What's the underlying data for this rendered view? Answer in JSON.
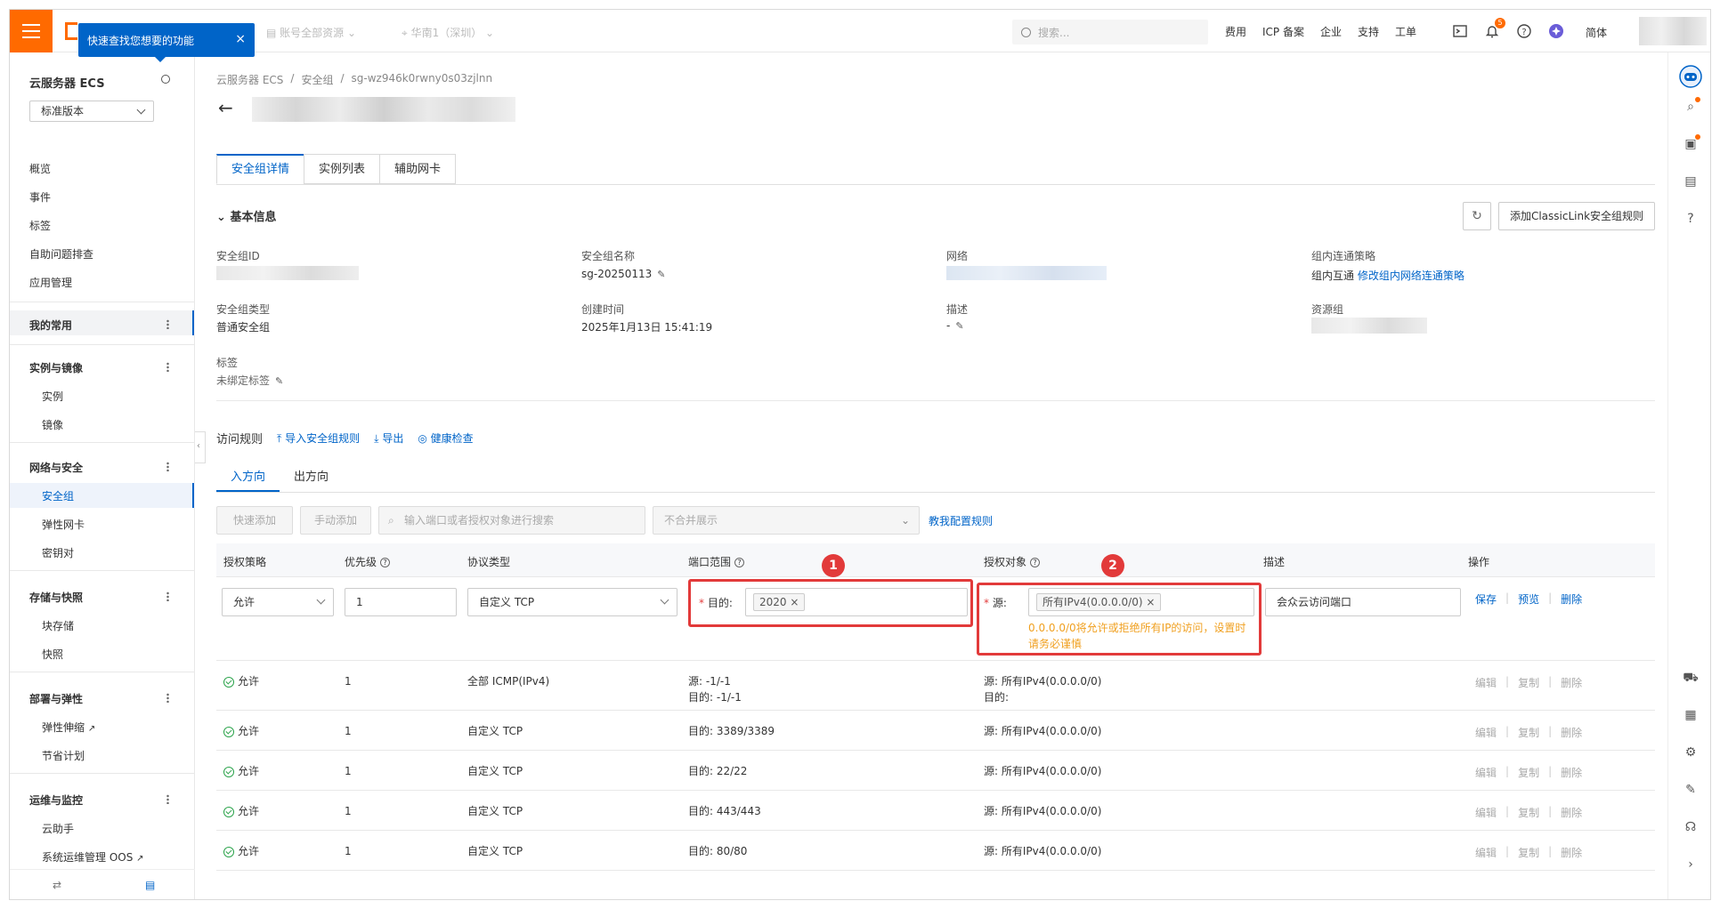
{
  "topbar": {
    "tooltip_text": "快速查找您想要的功能",
    "tooltip_close": "×",
    "resource_scope": "账号全部资源",
    "region": "华南1（深圳）",
    "search_placeholder": "搜索...",
    "links": [
      "费用",
      "ICP 备案",
      "企业",
      "支持",
      "工单"
    ],
    "notification_count": "5",
    "language": "简体"
  },
  "sidebar": {
    "title": "云服务器 ECS",
    "version_select": "标准版本",
    "top_items": [
      "概览",
      "事件",
      "标签",
      "自助问题排查",
      "应用管理"
    ],
    "favorites": "我的常用",
    "groups": [
      {
        "name": "实例与镜像",
        "items": [
          "实例",
          "镜像"
        ]
      },
      {
        "name": "网络与安全",
        "items": [
          "安全组",
          "弹性网卡",
          "密钥对"
        ]
      },
      {
        "name": "存储与快照",
        "items": [
          "块存储",
          "快照"
        ]
      },
      {
        "name": "部署与弹性",
        "items": [
          "弹性伸缩",
          "节省计划"
        ]
      },
      {
        "name": "运维与监控",
        "items": [
          "云助手",
          "系统运维管理 OOS"
        ]
      }
    ]
  },
  "breadcrumb": [
    "云服务器 ECS",
    "/",
    "安全组",
    "/",
    "sg-wz946k0rwny0s03zjlnn"
  ],
  "tabs": [
    "安全组详情",
    "实例列表",
    "辅助网卡"
  ],
  "basic_info": {
    "section_title": "基本信息",
    "classic_link_button": "添加ClassicLink安全组规则",
    "fields": {
      "sg_id_label": "安全组ID",
      "sg_name_label": "安全组名称",
      "sg_name_value": "sg-20250113",
      "network_label": "网络",
      "intra_policy_label": "组内连通策略",
      "intra_policy_value": "组内互通",
      "intra_policy_link": "修改组内网络连通策略",
      "sg_type_label": "安全组类型",
      "sg_type_value": "普通安全组",
      "created_label": "创建时间",
      "created_value": "2025年1月13日 15:41:19",
      "desc_label": "描述",
      "desc_value": "-",
      "resource_group_label": "资源组",
      "tags_label": "标签",
      "tags_value": "未绑定标签"
    }
  },
  "rules": {
    "title": "访问规则",
    "import_link": "导入安全组规则",
    "export_link": "导出",
    "health_link": "健康检查",
    "direction_tabs": [
      "入方向",
      "出方向"
    ],
    "toolbar": {
      "quick_add": "快速添加",
      "manual_add": "手动添加",
      "search_placeholder": "输入端口或者授权对象进行搜索",
      "merge_select": "不合并展示",
      "teach_link": "教我配置规则"
    },
    "columns": [
      "授权策略",
      "优先级",
      "协议类型",
      "端口范围",
      "授权对象",
      "描述",
      "操作"
    ],
    "edit_row": {
      "policy": "允许",
      "priority": "1",
      "protocol": "自定义 TCP",
      "port_label": "目的:",
      "port_tag": "2020",
      "source_label": "源:",
      "source_tag": "所有IPv4(0.0.0.0/0)",
      "warning": "0.0.0.0/0将允许或拒绝所有IP的访问，设置时请务必谨慎",
      "description": "会众云访问端口",
      "ops": [
        "保存",
        "预览",
        "删除"
      ],
      "badge_1": "1",
      "badge_2": "2"
    },
    "rows": [
      {
        "policy": "允许",
        "priority": "1",
        "protocol": "全部 ICMP(IPv4)",
        "port": "源: -1/-1",
        "port2": "目的: -1/-1",
        "auth": "源: 所有IPv4(0.0.0.0/0)",
        "auth2": "目的:",
        "ops": [
          "编辑",
          "复制",
          "删除"
        ]
      },
      {
        "policy": "允许",
        "priority": "1",
        "protocol": "自定义 TCP",
        "port": "目的: 3389/3389",
        "port2": "",
        "auth": "源: 所有IPv4(0.0.0.0/0)",
        "auth2": "",
        "ops": [
          "编辑",
          "复制",
          "删除"
        ]
      },
      {
        "policy": "允许",
        "priority": "1",
        "protocol": "自定义 TCP",
        "port": "目的: 22/22",
        "port2": "",
        "auth": "源: 所有IPv4(0.0.0.0/0)",
        "auth2": "",
        "ops": [
          "编辑",
          "复制",
          "删除"
        ]
      },
      {
        "policy": "允许",
        "priority": "1",
        "protocol": "自定义 TCP",
        "port": "目的: 443/443",
        "port2": "",
        "auth": "源: 所有IPv4(0.0.0.0/0)",
        "auth2": "",
        "ops": [
          "编辑",
          "复制",
          "删除"
        ]
      },
      {
        "policy": "允许",
        "priority": "1",
        "protocol": "自定义 TCP",
        "port": "目的: 80/80",
        "port2": "",
        "auth": "源: 所有IPv4(0.0.0.0/0)",
        "auth2": "",
        "ops": [
          "编辑",
          "复制",
          "删除"
        ]
      }
    ]
  },
  "colors": {
    "brand": "#ff6a00",
    "primary": "#0064c8",
    "highlight": "#e23a3a",
    "warning": "#f0a020",
    "allow": "#2aa34a"
  }
}
